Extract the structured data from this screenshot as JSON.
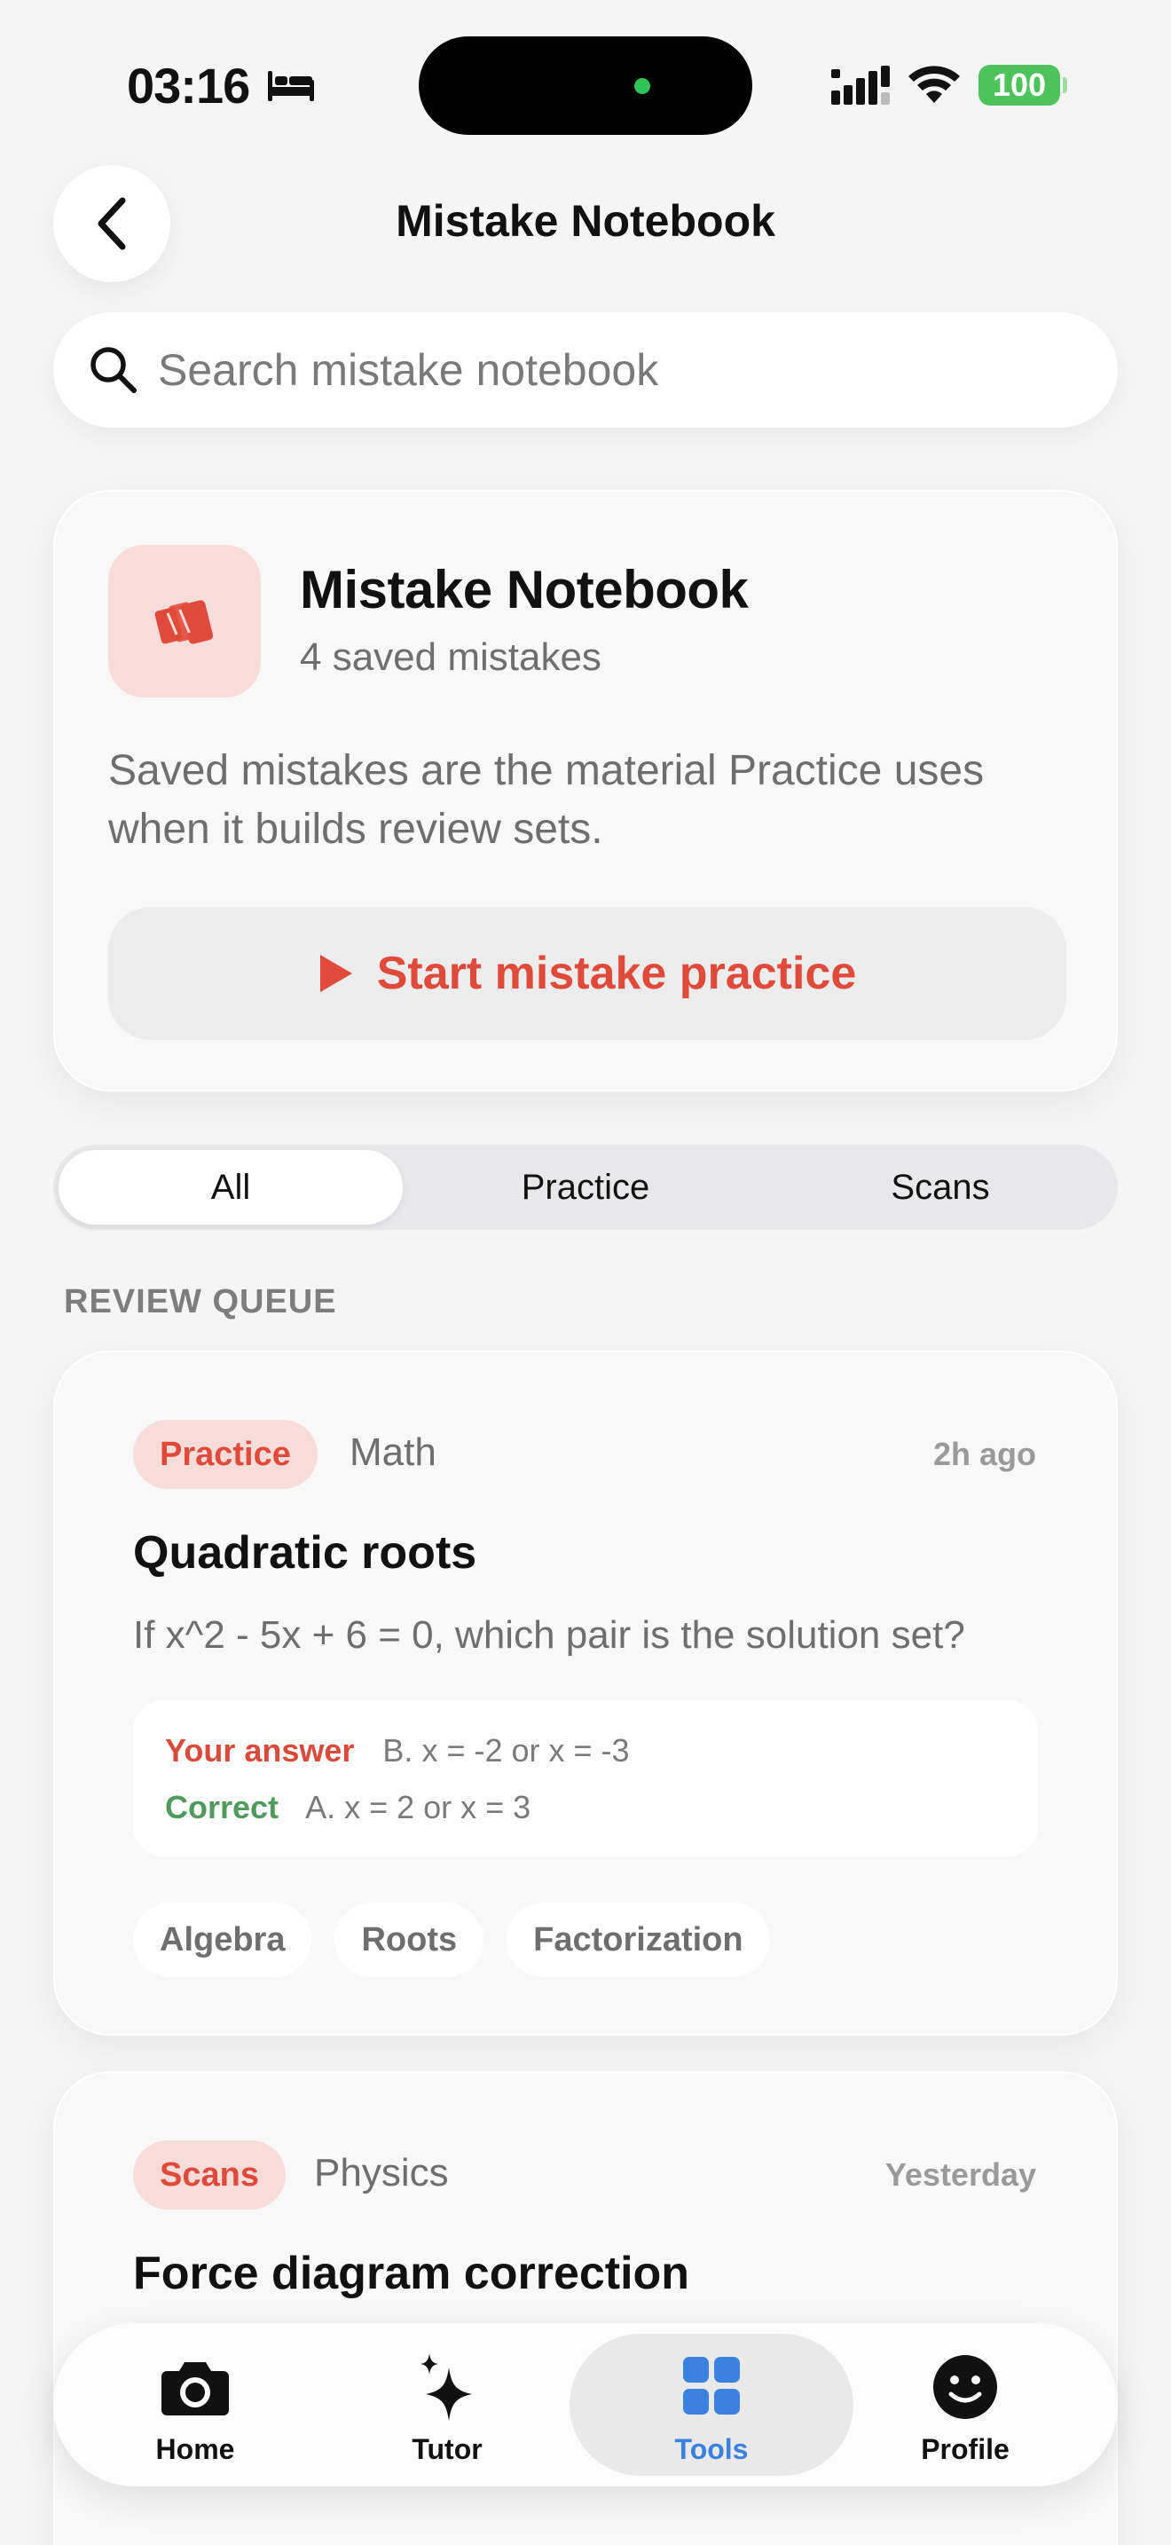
{
  "status_bar": {
    "time": "03:16",
    "battery": "100"
  },
  "header": {
    "title": "Mistake Notebook"
  },
  "search": {
    "placeholder": "Search mistake notebook"
  },
  "summary": {
    "title": "Mistake Notebook",
    "count": "4 saved mistakes",
    "description": "Saved mistakes are the material Practice uses when it builds review sets.",
    "start_button": "Start mistake practice"
  },
  "filters": {
    "options": [
      "All",
      "Practice",
      "Scans"
    ],
    "selected": "All"
  },
  "section_label": "REVIEW QUEUE",
  "mistakes": [
    {
      "source": "Practice",
      "subject": "Math",
      "time": "2h ago",
      "title": "Quadratic roots",
      "question": "If x^2 - 5x + 6 = 0, which pair is the solution set?",
      "your_answer_label": "Your answer",
      "your_answer": "B. x = -2 or x = -3",
      "correct_label": "Correct",
      "correct_answer": "A. x = 2 or x = 3",
      "tags": [
        "Algebra",
        "Roots",
        "Factorization"
      ]
    },
    {
      "source": "Scans",
      "subject": "Physics",
      "time": "Yesterday",
      "title": "Force diagram correction"
    }
  ],
  "tabbar": {
    "items": [
      {
        "label": "Home",
        "icon": "camera-icon"
      },
      {
        "label": "Tutor",
        "icon": "sparkles-icon"
      },
      {
        "label": "Tools",
        "icon": "grid-icon"
      },
      {
        "label": "Profile",
        "icon": "smiley-icon"
      }
    ],
    "active": "Tools"
  },
  "colors": {
    "accent_red": "#e04a3a",
    "active_blue": "#3b82e0",
    "correct_green": "#4f9a5c",
    "battery_green": "#4cc35b"
  }
}
